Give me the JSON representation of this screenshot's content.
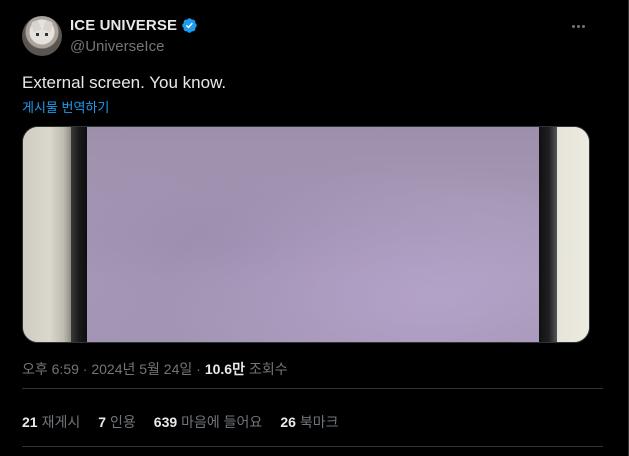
{
  "author": {
    "display_name": "ICE UNIVERSE",
    "handle": "@UniverseIce",
    "verified": true
  },
  "tweet": {
    "text": "External screen. You know.",
    "translate_label": "게시물 번역하기"
  },
  "meta": {
    "timestamp": "오후 6:59 · 2024년 5월 24일 ·",
    "views_count": "10.6만",
    "views_label": "조회수"
  },
  "stats": [
    {
      "count": "21",
      "label": "재게시"
    },
    {
      "count": "7",
      "label": "인용"
    },
    {
      "count": "639",
      "label": "마음에 들어요"
    },
    {
      "count": "26",
      "label": "북마크"
    }
  ],
  "colors": {
    "background": "#000000",
    "text": "#e7e9ea",
    "muted": "#71767b",
    "link": "#1d9bf0",
    "border": "#2f3336",
    "verified": "#1d9bf0"
  }
}
